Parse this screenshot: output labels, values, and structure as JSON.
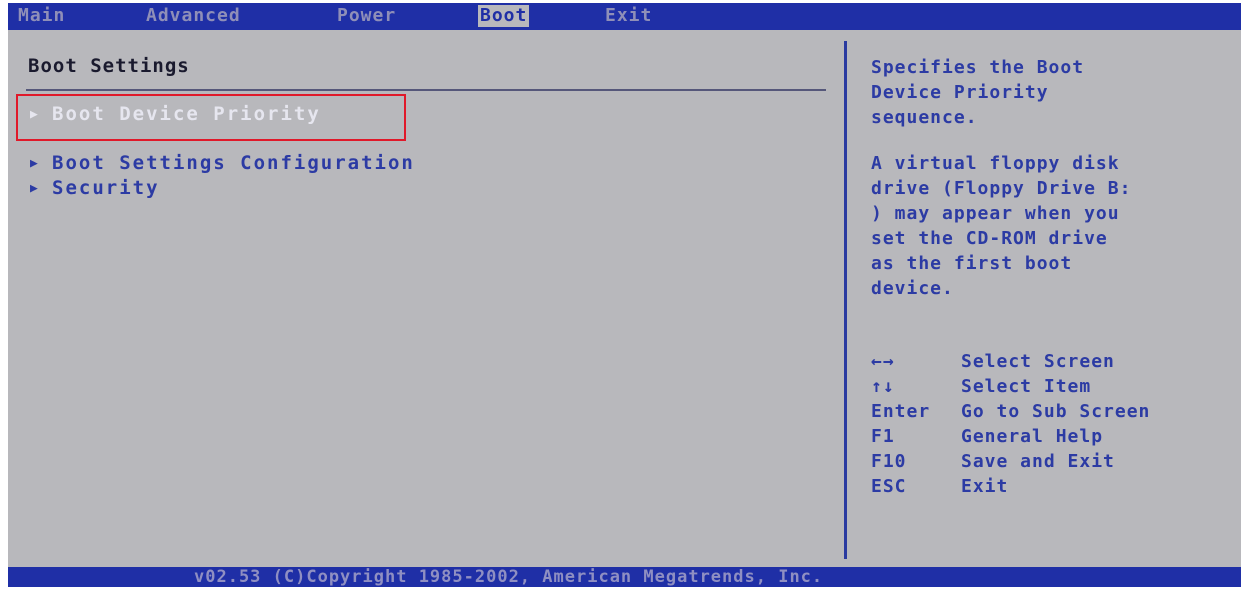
{
  "menu": {
    "items": [
      {
        "label": "Main"
      },
      {
        "label": "Advanced"
      },
      {
        "label": "Power"
      },
      {
        "label": "Boot"
      },
      {
        "label": "Exit"
      }
    ],
    "active": "Boot"
  },
  "main": {
    "title": "Boot Settings",
    "options": [
      {
        "label": "Boot Device Priority",
        "selected": true
      },
      {
        "label": "Boot Settings Configuration",
        "selected": false
      },
      {
        "label": "Security",
        "selected": false
      }
    ]
  },
  "help": {
    "line1": [
      "Specifies the Boot",
      "Device Priority",
      "sequence."
    ],
    "line2": [
      "A virtual floppy disk",
      "drive (Floppy Drive B:",
      ") may appear when you",
      "set the CD-ROM drive",
      "as the first boot",
      "device."
    ]
  },
  "keys": [
    {
      "key": "←→",
      "action": "Select Screen"
    },
    {
      "key": "↑↓",
      "action": "Select Item"
    },
    {
      "key": "Enter",
      "action": "Go to Sub Screen"
    },
    {
      "key": "F1",
      "action": "General Help"
    },
    {
      "key": "F10",
      "action": "Save and Exit"
    },
    {
      "key": "ESC",
      "action": "Exit"
    }
  ],
  "footer": {
    "text": "v02.53 (C)Copyright 1985-2002, American Megatrends, Inc."
  },
  "colors": {
    "bar": "#1f2fa6",
    "background": "#b8b8bc",
    "text": "#2c3ba4",
    "highlight": "#e0192a"
  }
}
